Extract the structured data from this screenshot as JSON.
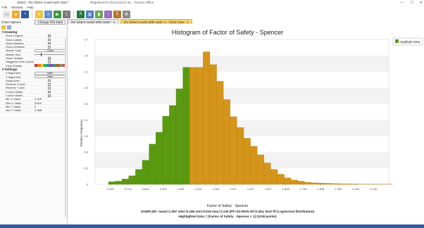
{
  "window": {
    "title": "Slide3 - RS Slide3 model With stats *",
    "registration": "Registered to Rocscience Inc., Toronto Office",
    "controls": [
      "—",
      "☐",
      "✕"
    ]
  },
  "menu": [
    "File",
    "Window",
    "Help"
  ],
  "tabs": [
    {
      "label": "RS Slide3 model With stats*",
      "active": false
    },
    {
      "label": "RS Slide3 model With stats* 2 - Chart View",
      "active": true
    }
  ],
  "chart_options": {
    "title": "Chart Options",
    "change_plot_data": "Change Plot Data",
    "sections": [
      {
        "name": "Drawing",
        "props": [
          {
            "name": "Show Legend",
            "type": "check",
            "checked": true
          },
          {
            "name": "Show Labels",
            "type": "check",
            "checked": false
          },
          {
            "name": "Show Markers",
            "type": "check",
            "checked": true
          },
          {
            "name": "Show Gridlines",
            "type": "check",
            "checked": false
          },
          {
            "name": "Marker Type",
            "type": "dropdown",
            "value": "Circle"
          },
          {
            "name": "Marker Size",
            "type": "slider",
            "value": 0.2
          },
          {
            "name": "Show Tooltips",
            "type": "check",
            "checked": true
          },
          {
            "name": "Staggered Axis Labels",
            "type": "check",
            "checked": false
          },
          {
            "name": "Chart Palette",
            "type": "palette"
          }
        ]
      },
      {
        "name": "Settings",
        "props": [
          {
            "name": "X Alignment",
            "type": "dropdown",
            "value": "Near"
          },
          {
            "name": "Y Alignment",
            "type": "dropdown",
            "value": "Near"
          },
          {
            "name": "Swap Axes",
            "type": "check",
            "checked": false
          },
          {
            "name": "Reverse X-Axis",
            "type": "check",
            "checked": false
          },
          {
            "name": "Reverse Y-Axis",
            "type": "check",
            "checked": false
          },
          {
            "name": "X-Axis Visible",
            "type": "check",
            "checked": true
          },
          {
            "name": "Y-Axis Visible",
            "type": "check",
            "checked": true
          },
          {
            "name": "Min X Value",
            "type": "text",
            "value": "2.125"
          },
          {
            "name": "Max X Value",
            "type": "text",
            "value": "0.619"
          },
          {
            "name": "Min Y Value",
            "type": "text",
            "value": "0"
          },
          {
            "name": "Max Y Value",
            "type": "text",
            "value": "2.488"
          }
        ]
      }
    ],
    "palette": [
      "#c0392b",
      "#e67e22",
      "#f1c40f",
      "#27ae60",
      "#2980b9",
      "#8e44ad",
      "#16a085",
      "#d35400",
      "#7f8c8d",
      "#e74c3c"
    ]
  },
  "colors": {
    "below_threshold": "#5b9a10",
    "above_threshold": "#d4951a",
    "status_bar": "#2f5aa0"
  },
  "chart_data": {
    "type": "bar",
    "title": "Histogram of Factor of Safety - Spencer",
    "xlabel": "Factor of Safety - Spencer",
    "ylabel": "Relative Frequency",
    "legend": [
      "Highlight Data"
    ],
    "legend_position": "top-right",
    "x_tick_labels": [
      "0.622",
      "0.724",
      "0.824",
      "0.925",
      "1.025",
      "1.126",
      "1.226",
      "1.327",
      "1.427",
      "1.527",
      "1.628",
      "1.728",
      "1.828",
      "1.929",
      "2.029",
      "2.130"
    ],
    "y_tick_labels": [
      "0",
      "0.3",
      "0.6",
      "0.9",
      "1.2",
      "1.5",
      "1.8",
      "2.1",
      "2.4",
      "2.7"
    ],
    "ylim": [
      0,
      2.7
    ],
    "bars": [
      {
        "value": 0.05,
        "highlighted": true
      },
      {
        "value": 0.06,
        "highlighted": true
      },
      {
        "value": 0.1,
        "highlighted": true
      },
      {
        "value": 0.16,
        "highlighted": true
      },
      {
        "value": 0.28,
        "highlighted": true
      },
      {
        "value": 0.45,
        "highlighted": true
      },
      {
        "value": 0.75,
        "highlighted": true
      },
      {
        "value": 0.97,
        "highlighted": true
      },
      {
        "value": 1.27,
        "highlighted": true
      },
      {
        "value": 1.47,
        "highlighted": true
      },
      {
        "value": 1.78,
        "highlighted": true
      },
      {
        "value": 2.18,
        "highlighted": true
      },
      {
        "value": 2.18,
        "highlighted": false
      },
      {
        "value": 2.18,
        "highlighted": false
      },
      {
        "value": 2.47,
        "highlighted": false
      },
      {
        "value": 2.23,
        "highlighted": false
      },
      {
        "value": 1.92,
        "highlighted": false
      },
      {
        "value": 1.58,
        "highlighted": false
      },
      {
        "value": 1.26,
        "highlighted": false
      },
      {
        "value": 1.06,
        "highlighted": false
      },
      {
        "value": 0.86,
        "highlighted": false
      },
      {
        "value": 0.71,
        "highlighted": false
      },
      {
        "value": 0.55,
        "highlighted": false
      },
      {
        "value": 0.4,
        "highlighted": false
      },
      {
        "value": 0.28,
        "highlighted": false
      },
      {
        "value": 0.19,
        "highlighted": false
      },
      {
        "value": 0.12,
        "highlighted": false
      },
      {
        "value": 0.08,
        "highlighted": false
      },
      {
        "value": 0.06,
        "highlighted": false
      },
      {
        "value": 0.04,
        "highlighted": false
      },
      {
        "value": 0.03,
        "highlighted": false
      },
      {
        "value": 0.025,
        "highlighted": false
      },
      {
        "value": 0.02,
        "highlighted": false
      },
      {
        "value": 0.015,
        "highlighted": false
      },
      {
        "value": 0.012,
        "highlighted": false
      },
      {
        "value": 0.01,
        "highlighted": false
      },
      {
        "value": 0.008,
        "highlighted": false
      },
      {
        "value": 0.006,
        "highlighted": false
      },
      {
        "value": 0.005,
        "highlighted": false
      },
      {
        "value": 0.005,
        "highlighted": false
      },
      {
        "value": 0.004,
        "highlighted": false
      },
      {
        "value": 0.003,
        "highlighted": false
      }
    ],
    "stats_line": "SAMPLED: mean=1.087 stdv=0.186 min=0.619 max=2.125 (PF=33.053% RI=0.404, best fit=Lognormal distribution)",
    "highlight_line": "Highlighted Data = [Factor of Safety - Spencer < 1] (1018 points)"
  }
}
